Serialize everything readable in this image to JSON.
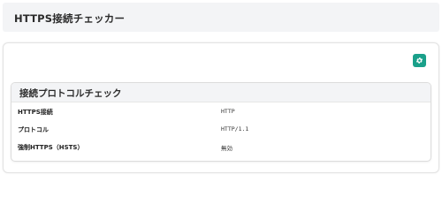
{
  "header": {
    "title": "HTTPS接続チェッカー"
  },
  "toolbar": {
    "settings_icon": "gear-icon",
    "settings_color": "#1aa08a"
  },
  "section": {
    "title": "接続プロトコルチェック",
    "rows": [
      {
        "label": "HTTPS接続",
        "value": "HTTP"
      },
      {
        "label": "プロトコル",
        "value": "HTTP/1.1"
      },
      {
        "label": "強制HTTPS（HSTS）",
        "value": "無効"
      }
    ]
  }
}
